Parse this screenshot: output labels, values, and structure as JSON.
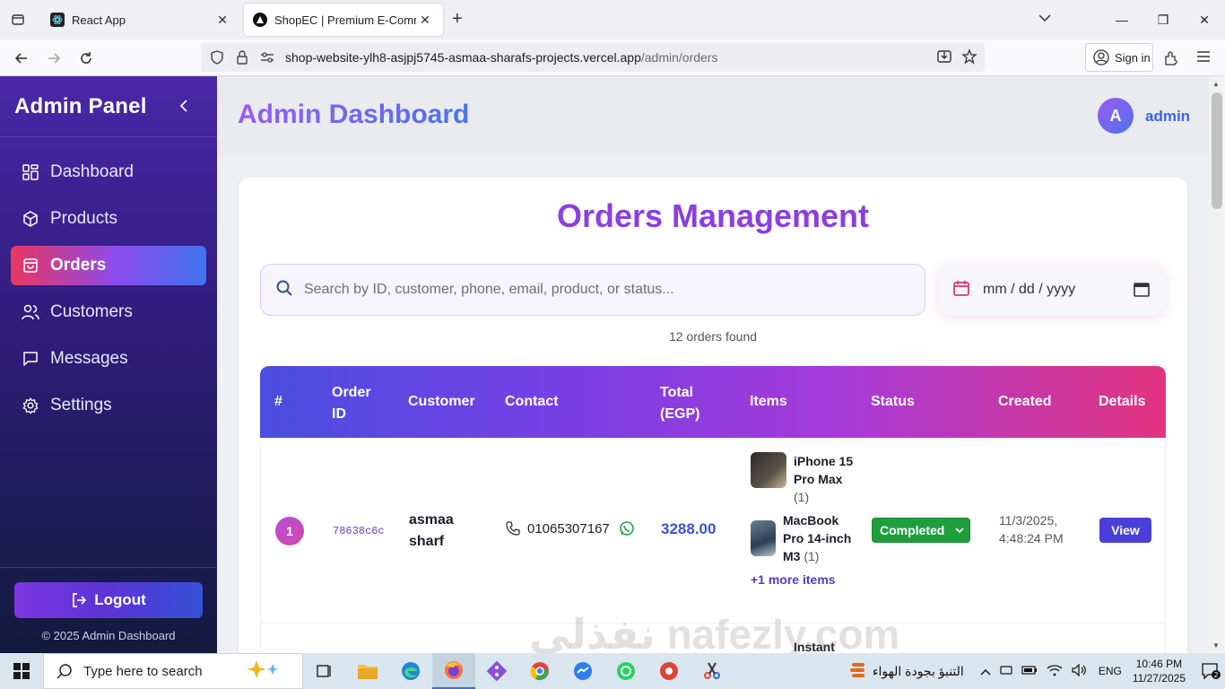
{
  "browser": {
    "tabs": [
      {
        "title": "React App",
        "active": false
      },
      {
        "title": "ShopEC | Premium E-Commerce",
        "active": true
      }
    ],
    "url_host": "shop-website-ylh8-asjpj5745-asmaa-sharafs-projects.vercel.app",
    "url_path": "/admin/orders",
    "sign_in": "Sign in"
  },
  "sidebar": {
    "title": "Admin Panel",
    "items": [
      {
        "label": "Dashboard",
        "icon": "dashboard-icon",
        "active": false
      },
      {
        "label": "Products",
        "icon": "box-icon",
        "active": false
      },
      {
        "label": "Orders",
        "icon": "bag-icon",
        "active": true
      },
      {
        "label": "Customers",
        "icon": "users-icon",
        "active": false
      },
      {
        "label": "Messages",
        "icon": "message-icon",
        "active": false
      },
      {
        "label": "Settings",
        "icon": "gear-icon",
        "active": false
      }
    ],
    "logout_label": "Logout",
    "copyright": "© 2025 Admin Dashboard"
  },
  "header": {
    "title": "Admin Dashboard",
    "avatar_letter": "A",
    "user_name": "admin"
  },
  "orders": {
    "title": "Orders Management",
    "search_placeholder": "Search by ID, customer, phone, email, product, or status...",
    "date_placeholder": "mm / dd / yyyy",
    "count_text": "12 orders found",
    "columns": [
      "#",
      "Order ID",
      "Customer",
      "Contact",
      "Total (EGP)",
      "Items",
      "Status",
      "Created",
      "Details"
    ],
    "rows": [
      {
        "index": "1",
        "order_id": "78638c6c",
        "customer": "asmaa sharf",
        "phone": "01065307167",
        "total": "3288.00",
        "items": [
          {
            "name": "iPhone 15 Pro Max",
            "qty": "(1)"
          },
          {
            "name": "MacBook Pro 14-inch M3",
            "qty": "(1)"
          }
        ],
        "more_items": "+1 more items",
        "status": "Completed",
        "created_date": "11/3/2025,",
        "created_time": "4:48:24 PM",
        "details_label": "View"
      }
    ],
    "next_row_item": "Instant"
  },
  "watermark": "نفذلي nafezly.com",
  "taskbar": {
    "search_placeholder": "Type here to search",
    "weather": "التنبؤ بجودة الهواء",
    "language": "ENG",
    "time": "10:46 PM",
    "date": "11/27/2025",
    "notification_count": "2"
  },
  "colors": {
    "accent_purple": "#8b3fe0",
    "accent_blue": "#3d63e8",
    "status_completed": "#1f9e3e",
    "view_button": "#4b3fd9"
  }
}
